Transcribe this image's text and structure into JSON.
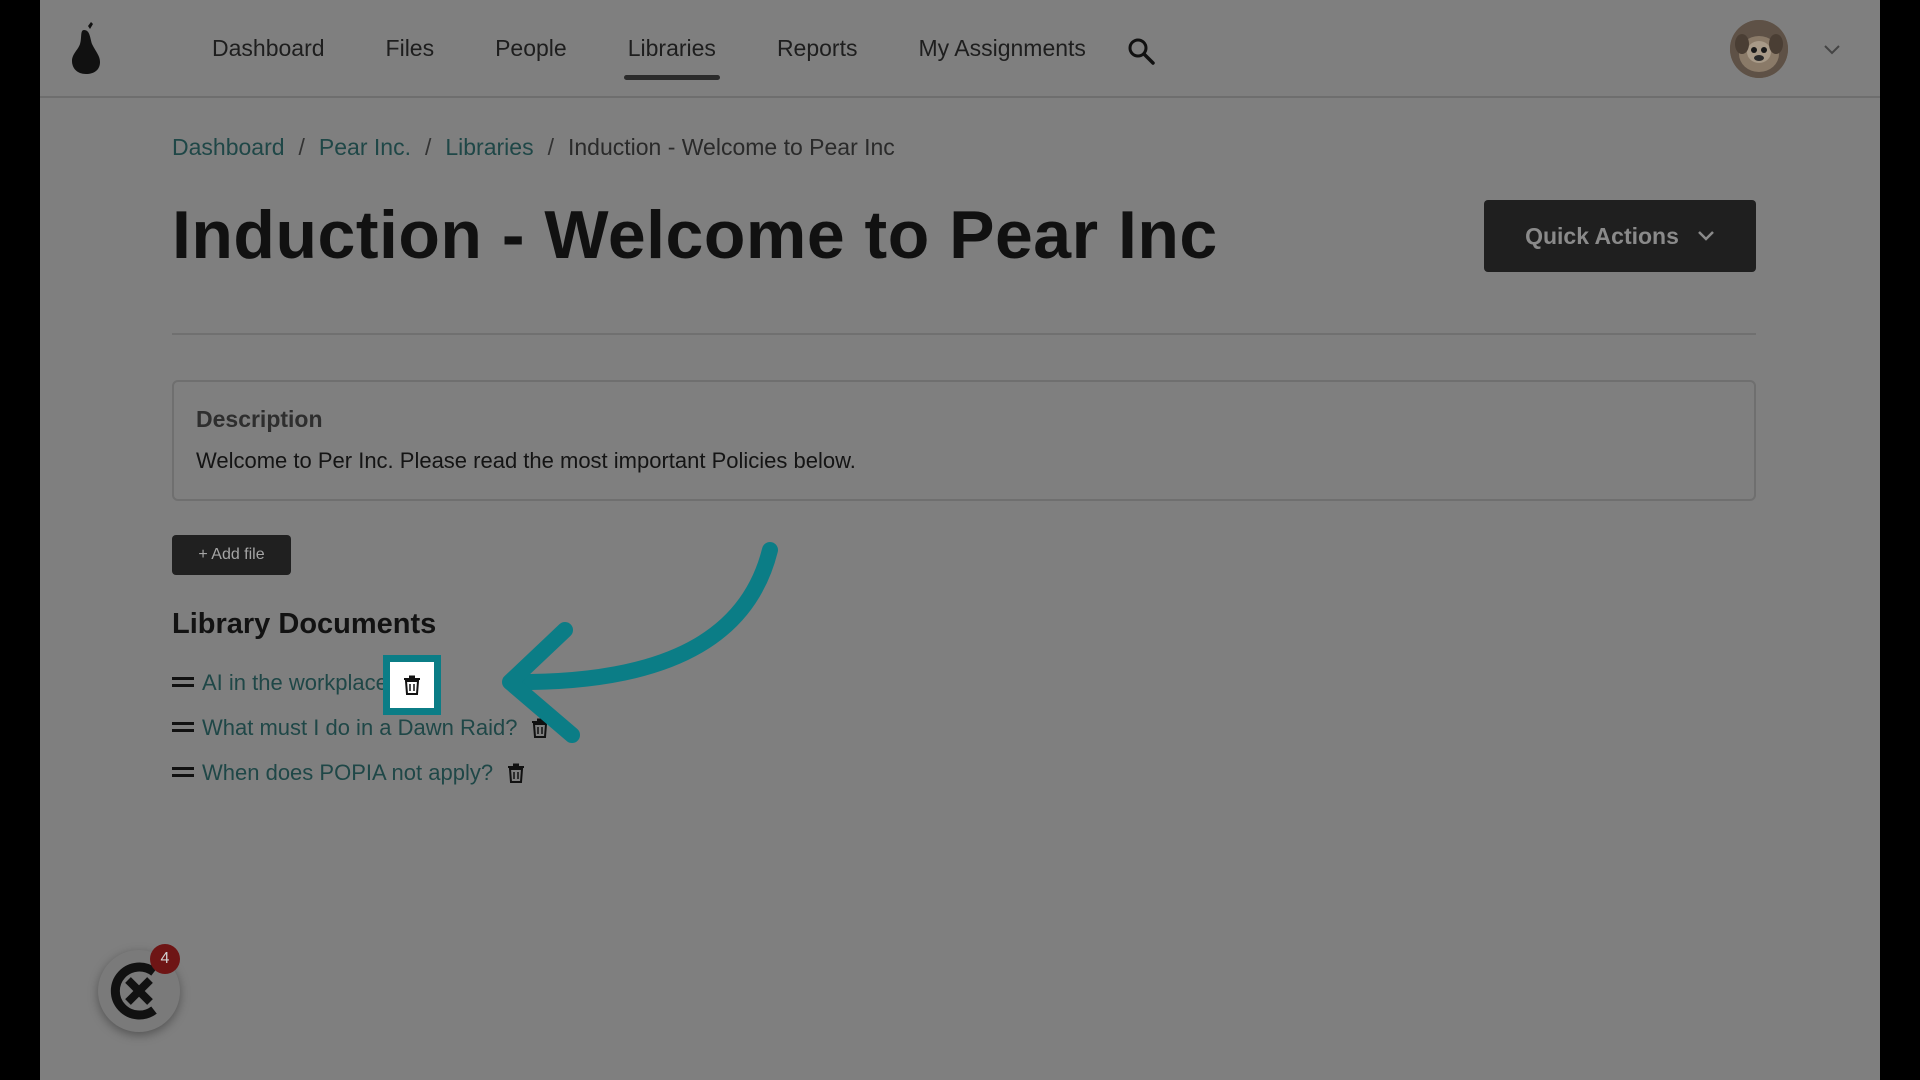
{
  "nav": {
    "items": [
      {
        "label": "Dashboard",
        "active": false
      },
      {
        "label": "Files",
        "active": false
      },
      {
        "label": "People",
        "active": false
      },
      {
        "label": "Libraries",
        "active": true
      },
      {
        "label": "Reports",
        "active": false
      },
      {
        "label": "My Assignments",
        "active": false
      }
    ],
    "search_icon": "search-icon"
  },
  "breadcrumb": {
    "items": [
      "Dashboard",
      "Pear Inc.",
      "Libraries"
    ],
    "separator": "/",
    "current": "Induction - Welcome to Pear Inc"
  },
  "page": {
    "title": "Induction - Welcome to Pear Inc",
    "quick_actions_label": "Quick Actions"
  },
  "description": {
    "heading": "Description",
    "text": "Welcome to Per Inc. Please read the most important Policies below."
  },
  "add_file_label": "+ Add file",
  "library": {
    "heading": "Library Documents",
    "documents": [
      {
        "title": "AI in the workplace",
        "highlighted": true
      },
      {
        "title": "What must I do in a Dawn Raid?",
        "highlighted": false
      },
      {
        "title": "When does POPIA not apply?",
        "highlighted": false
      }
    ]
  },
  "chat_widget": {
    "badge_count": "4"
  },
  "colors": {
    "overlay": "#7f7f7f",
    "accent_teal": "#0b7d86",
    "link": "#1f4747",
    "button_dark": "#1f1f1f",
    "badge": "#6e1515"
  }
}
